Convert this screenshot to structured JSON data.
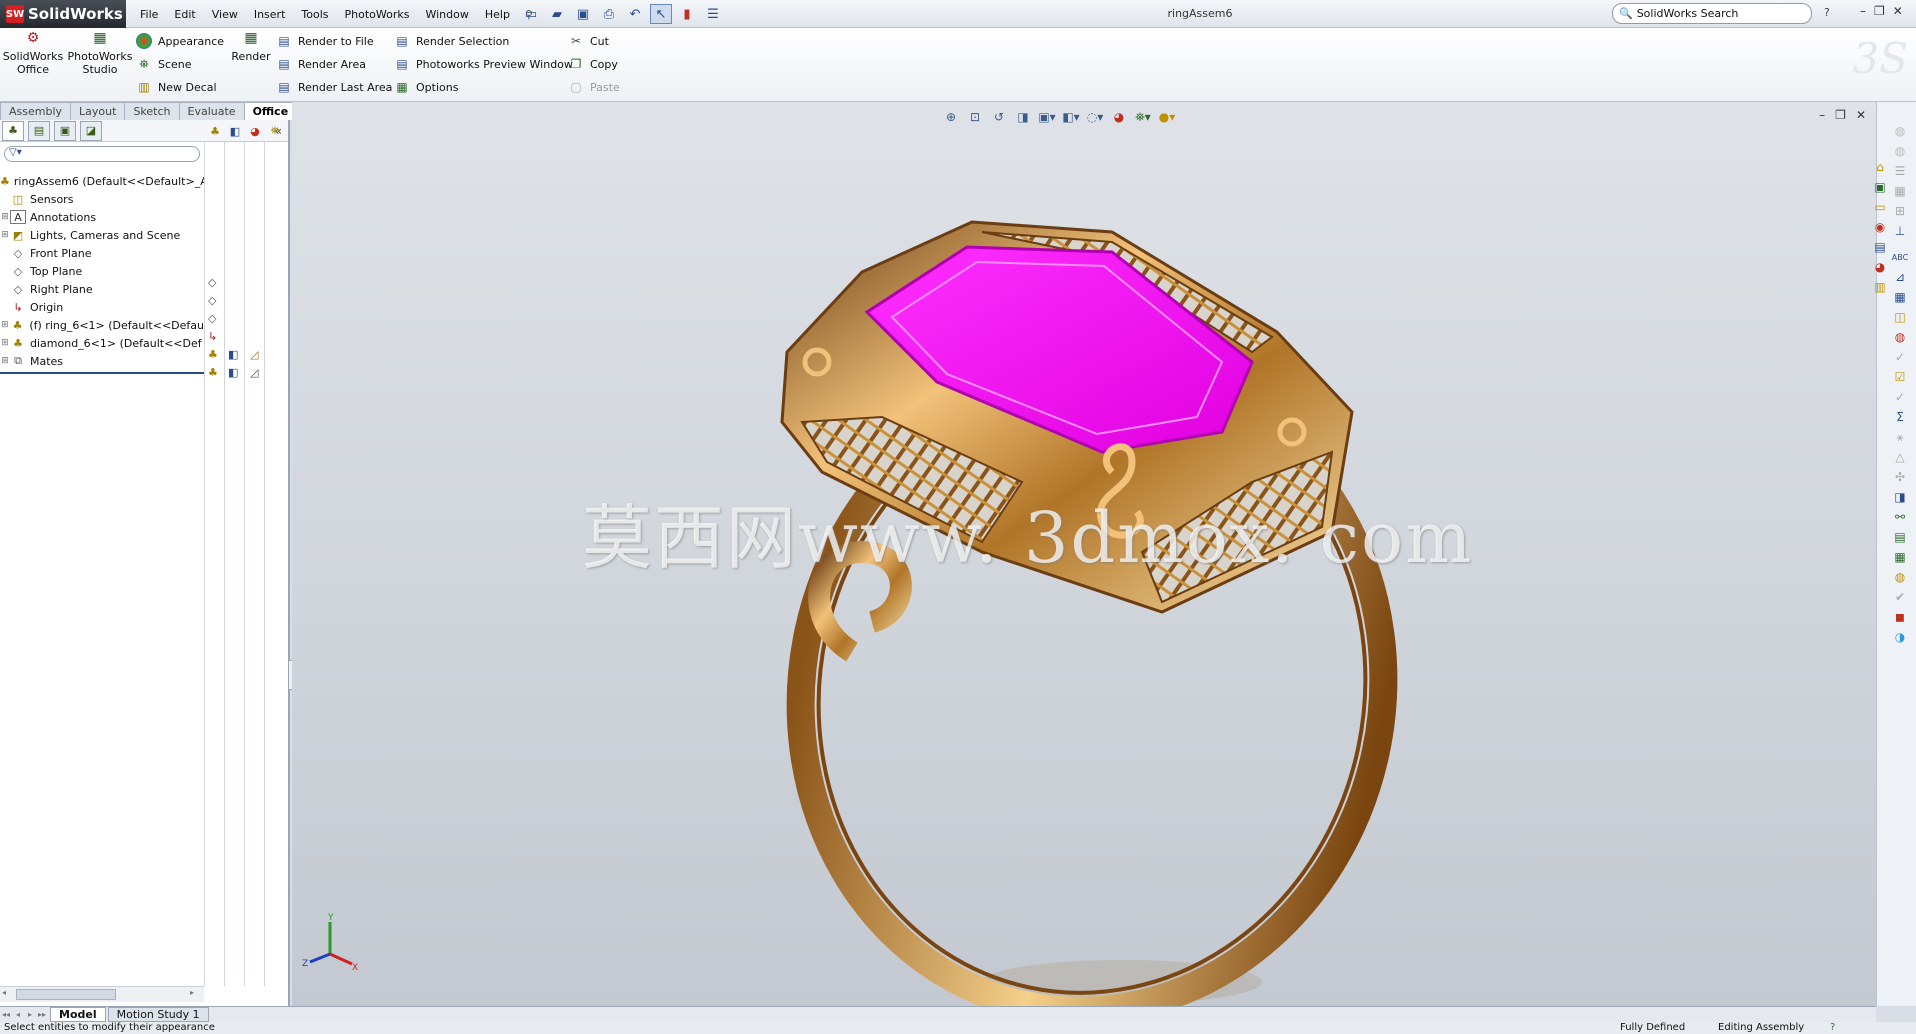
{
  "app": {
    "logo_text": "SolidWorks",
    "document_title": "ringAssem6",
    "search_placeholder": "SolidWorks Search",
    "help_glyph": "?"
  },
  "menu": [
    "File",
    "Edit",
    "View",
    "Insert",
    "Tools",
    "PhotoWorks",
    "Window",
    "Help"
  ],
  "command_manager": {
    "big_buttons": [
      {
        "label": "SolidWorks Office",
        "icon": "solidworks-office-icon"
      },
      {
        "label": "PhotoWorks Studio",
        "icon": "photoworks-studio-icon"
      },
      {
        "label": "Render",
        "icon": "render-icon"
      }
    ],
    "col1": [
      {
        "label": "Appearance",
        "icon": "appearance-icon"
      },
      {
        "label": "Scene",
        "icon": "scene-icon"
      },
      {
        "label": "New Decal",
        "icon": "decal-icon"
      }
    ],
    "col2": [
      {
        "label": "Render to File",
        "icon": "render-to-file-icon"
      },
      {
        "label": "Render Area",
        "icon": "render-area-icon"
      },
      {
        "label": "Render Last Area",
        "icon": "render-last-area-icon"
      }
    ],
    "col3": [
      {
        "label": "Render Selection",
        "icon": "render-selection-icon"
      },
      {
        "label": "Photoworks Preview Window",
        "icon": "preview-window-icon"
      },
      {
        "label": "Options",
        "icon": "options-icon"
      }
    ],
    "col4": [
      {
        "label": "Cut",
        "icon": "cut-icon"
      },
      {
        "label": "Copy",
        "icon": "copy-icon"
      },
      {
        "label": "Paste",
        "icon": "paste-icon",
        "disabled": true
      }
    ]
  },
  "tabs": [
    "Assembly",
    "Layout",
    "Sketch",
    "Evaluate",
    "Office Products"
  ],
  "active_tab": "Office Products",
  "tree": {
    "root": "ringAssem6  (Default<<Default>_A",
    "items": [
      {
        "label": "Sensors",
        "icon": "sensors-icon",
        "expandable": false
      },
      {
        "label": "Annotations",
        "icon": "annotations-icon",
        "expandable": true
      },
      {
        "label": "Lights, Cameras and Scene",
        "icon": "lights-icon",
        "expandable": true
      },
      {
        "label": "Front Plane",
        "icon": "plane-icon",
        "expandable": false
      },
      {
        "label": "Top Plane",
        "icon": "plane-icon",
        "expandable": false
      },
      {
        "label": "Right Plane",
        "icon": "plane-icon",
        "expandable": false
      },
      {
        "label": "Origin",
        "icon": "origin-icon",
        "expandable": false
      },
      {
        "label": "(f) ring_6<1> (Default<<Defau",
        "icon": "part-icon",
        "expandable": true
      },
      {
        "label": "diamond_6<1> (Default<<Def",
        "icon": "part-icon",
        "expandable": true
      },
      {
        "label": "Mates",
        "icon": "mates-icon",
        "expandable": true
      }
    ]
  },
  "viewport": {
    "watermark": "莫西网www. 3dmox. com"
  },
  "bottom_tabs": [
    "Model",
    "Motion Study 1"
  ],
  "status": {
    "message": "Select entities to modify their appearance",
    "defined": "Fully Defined",
    "editing": "Editing Assembly",
    "help_glyph": "?"
  },
  "colors": {
    "gem": "#ff00ff",
    "gold": "#c8913a",
    "accent": "#2b4d8c"
  }
}
